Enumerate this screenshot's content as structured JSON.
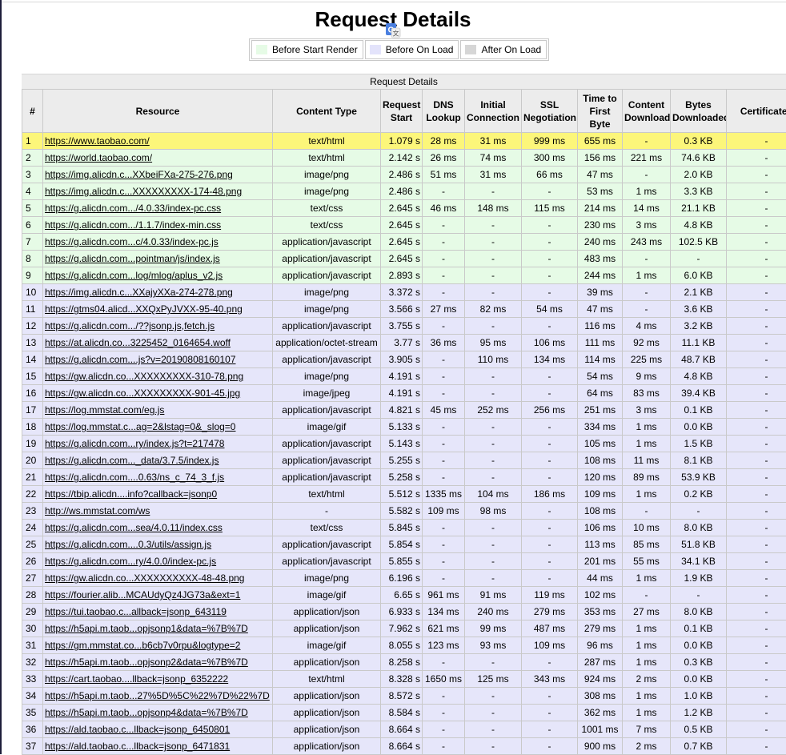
{
  "page": {
    "title": "Request Details"
  },
  "legend": [
    {
      "label": "Before Start Render",
      "color": "#e6fbe6"
    },
    {
      "label": "Before On Load",
      "color": "#e3e3fb"
    },
    {
      "label": "After On Load",
      "color": "#d6d6d6"
    }
  ],
  "table": {
    "caption": "Request Details",
    "headers": [
      "#",
      "Resource",
      "Content Type",
      "Request Start",
      "DNS Lookup",
      "Initial Connection",
      "SSL Negotiation",
      "Time to First Byte",
      "Content Download",
      "Bytes Downloaded",
      "Certificates"
    ],
    "row_colors": {
      "highlight": "#fcf67a",
      "start_render": "#e6fbe6",
      "on_load": "#e6e6fa"
    },
    "rows": [
      {
        "n": "1",
        "url": "https://www.taobao.com/",
        "type": "text/html",
        "start": "1.079 s",
        "dns": "28 ms",
        "conn": "31 ms",
        "ssl": "999 ms",
        "ttfb": "655 ms",
        "dl": "-",
        "bytes": "0.3 KB",
        "cert": "-",
        "phase": "highlight"
      },
      {
        "n": "2",
        "url": "https://world.taobao.com/",
        "type": "text/html",
        "start": "2.142 s",
        "dns": "26 ms",
        "conn": "74 ms",
        "ssl": "300 ms",
        "ttfb": "156 ms",
        "dl": "221 ms",
        "bytes": "74.6 KB",
        "cert": "-",
        "phase": "start_render"
      },
      {
        "n": "3",
        "url": "https://img.alicdn.c...XXbeiFXa-275-276.png",
        "type": "image/png",
        "start": "2.486 s",
        "dns": "51 ms",
        "conn": "31 ms",
        "ssl": "66 ms",
        "ttfb": "47 ms",
        "dl": "-",
        "bytes": "2.0 KB",
        "cert": "-",
        "phase": "start_render"
      },
      {
        "n": "4",
        "url": "https://img.alicdn.c...XXXXXXXXX-174-48.png",
        "type": "image/png",
        "start": "2.486 s",
        "dns": "-",
        "conn": "-",
        "ssl": "-",
        "ttfb": "53 ms",
        "dl": "1 ms",
        "bytes": "3.3 KB",
        "cert": "-",
        "phase": "start_render"
      },
      {
        "n": "5",
        "url": "https://g.alicdn.com.../4.0.33/index-pc.css",
        "type": "text/css",
        "start": "2.645 s",
        "dns": "46 ms",
        "conn": "148 ms",
        "ssl": "115 ms",
        "ttfb": "214 ms",
        "dl": "14 ms",
        "bytes": "21.1 KB",
        "cert": "-",
        "phase": "start_render"
      },
      {
        "n": "6",
        "url": "https://g.alicdn.com.../1.1.7/index-min.css",
        "type": "text/css",
        "start": "2.645 s",
        "dns": "-",
        "conn": "-",
        "ssl": "-",
        "ttfb": "230 ms",
        "dl": "3 ms",
        "bytes": "4.8 KB",
        "cert": "-",
        "phase": "start_render"
      },
      {
        "n": "7",
        "url": "https://g.alicdn.com...c/4.0.33/index-pc.js",
        "type": "application/javascript",
        "start": "2.645 s",
        "dns": "-",
        "conn": "-",
        "ssl": "-",
        "ttfb": "240 ms",
        "dl": "243 ms",
        "bytes": "102.5 KB",
        "cert": "-",
        "phase": "start_render"
      },
      {
        "n": "8",
        "url": "https://g.alicdn.com...pointman/js/index.js",
        "type": "application/javascript",
        "start": "2.645 s",
        "dns": "-",
        "conn": "-",
        "ssl": "-",
        "ttfb": "483 ms",
        "dl": "-",
        "bytes": "-",
        "cert": "-",
        "phase": "start_render"
      },
      {
        "n": "9",
        "url": "https://g.alicdn.com...log/mlog/aplus_v2.js",
        "type": "application/javascript",
        "start": "2.893 s",
        "dns": "-",
        "conn": "-",
        "ssl": "-",
        "ttfb": "244 ms",
        "dl": "1 ms",
        "bytes": "6.0 KB",
        "cert": "-",
        "phase": "start_render"
      },
      {
        "n": "10",
        "url": "https://img.alicdn.c...XXajyXXa-274-278.png",
        "type": "image/png",
        "start": "3.372 s",
        "dns": "-",
        "conn": "-",
        "ssl": "-",
        "ttfb": "39 ms",
        "dl": "-",
        "bytes": "2.1 KB",
        "cert": "-",
        "phase": "on_load"
      },
      {
        "n": "11",
        "url": "https://gtms04.alicd...XXQxPyJVXX-95-40.png",
        "type": "image/png",
        "start": "3.566 s",
        "dns": "27 ms",
        "conn": "82 ms",
        "ssl": "54 ms",
        "ttfb": "47 ms",
        "dl": "-",
        "bytes": "3.6 KB",
        "cert": "-",
        "phase": "on_load"
      },
      {
        "n": "12",
        "url": "https://g.alicdn.com.../??jsonp.js,fetch.js",
        "type": "application/javascript",
        "start": "3.755 s",
        "dns": "-",
        "conn": "-",
        "ssl": "-",
        "ttfb": "116 ms",
        "dl": "4 ms",
        "bytes": "3.2 KB",
        "cert": "-",
        "phase": "on_load"
      },
      {
        "n": "13",
        "url": "https://at.alicdn.co...3225452_0164654.woff",
        "type": "application/octet-stream",
        "start": "3.77 s",
        "dns": "36 ms",
        "conn": "95 ms",
        "ssl": "106 ms",
        "ttfb": "111 ms",
        "dl": "92 ms",
        "bytes": "11.1 KB",
        "cert": "-",
        "phase": "on_load"
      },
      {
        "n": "14",
        "url": "https://g.alicdn.com....js?v=20190808160107",
        "type": "application/javascript",
        "start": "3.905 s",
        "dns": "-",
        "conn": "110 ms",
        "ssl": "134 ms",
        "ttfb": "114 ms",
        "dl": "225 ms",
        "bytes": "48.7 KB",
        "cert": "-",
        "phase": "on_load"
      },
      {
        "n": "15",
        "url": "https://gw.alicdn.co...XXXXXXXXX-310-78.png",
        "type": "image/png",
        "start": "4.191 s",
        "dns": "-",
        "conn": "-",
        "ssl": "-",
        "ttfb": "54 ms",
        "dl": "9 ms",
        "bytes": "4.8 KB",
        "cert": "-",
        "phase": "on_load"
      },
      {
        "n": "16",
        "url": "https://gw.alicdn.co...XXXXXXXXX-901-45.jpg",
        "type": "image/jpeg",
        "start": "4.191 s",
        "dns": "-",
        "conn": "-",
        "ssl": "-",
        "ttfb": "64 ms",
        "dl": "83 ms",
        "bytes": "39.4 KB",
        "cert": "-",
        "phase": "on_load"
      },
      {
        "n": "17",
        "url": "https://log.mmstat.com/eg.js",
        "type": "application/javascript",
        "start": "4.821 s",
        "dns": "45 ms",
        "conn": "252 ms",
        "ssl": "256 ms",
        "ttfb": "251 ms",
        "dl": "3 ms",
        "bytes": "0.1 KB",
        "cert": "-",
        "phase": "on_load"
      },
      {
        "n": "18",
        "url": "https://log.mmstat.c...ag=2&lstag=0&_slog=0",
        "type": "image/gif",
        "start": "5.133 s",
        "dns": "-",
        "conn": "-",
        "ssl": "-",
        "ttfb": "334 ms",
        "dl": "1 ms",
        "bytes": "0.0 KB",
        "cert": "-",
        "phase": "on_load"
      },
      {
        "n": "19",
        "url": "https://g.alicdn.com...ry/index.js?t=217478",
        "type": "application/javascript",
        "start": "5.143 s",
        "dns": "-",
        "conn": "-",
        "ssl": "-",
        "ttfb": "105 ms",
        "dl": "1 ms",
        "bytes": "1.5 KB",
        "cert": "-",
        "phase": "on_load"
      },
      {
        "n": "20",
        "url": "https://g.alicdn.com..._data/3.7.5/index.js",
        "type": "application/javascript",
        "start": "5.255 s",
        "dns": "-",
        "conn": "-",
        "ssl": "-",
        "ttfb": "108 ms",
        "dl": "11 ms",
        "bytes": "8.1 KB",
        "cert": "-",
        "phase": "on_load"
      },
      {
        "n": "21",
        "url": "https://g.alicdn.com....0.63/ns_c_74_3_f.js",
        "type": "application/javascript",
        "start": "5.258 s",
        "dns": "-",
        "conn": "-",
        "ssl": "-",
        "ttfb": "120 ms",
        "dl": "89 ms",
        "bytes": "53.9 KB",
        "cert": "-",
        "phase": "on_load"
      },
      {
        "n": "22",
        "url": "https://tbip.alicdn....info?callback=jsonp0",
        "type": "text/html",
        "start": "5.512 s",
        "dns": "1335 ms",
        "conn": "104 ms",
        "ssl": "186 ms",
        "ttfb": "109 ms",
        "dl": "1 ms",
        "bytes": "0.2 KB",
        "cert": "-",
        "phase": "on_load"
      },
      {
        "n": "23",
        "url": "http://ws.mmstat.com/ws",
        "type": "-",
        "start": "5.582 s",
        "dns": "109 ms",
        "conn": "98 ms",
        "ssl": "-",
        "ttfb": "108 ms",
        "dl": "-",
        "bytes": "-",
        "cert": "-",
        "phase": "on_load"
      },
      {
        "n": "24",
        "url": "https://g.alicdn.com...sea/4.0.11/index.css",
        "type": "text/css",
        "start": "5.845 s",
        "dns": "-",
        "conn": "-",
        "ssl": "-",
        "ttfb": "106 ms",
        "dl": "10 ms",
        "bytes": "8.0 KB",
        "cert": "-",
        "phase": "on_load"
      },
      {
        "n": "25",
        "url": "https://g.alicdn.com....0.3/utils/assign.js",
        "type": "application/javascript",
        "start": "5.854 s",
        "dns": "-",
        "conn": "-",
        "ssl": "-",
        "ttfb": "113 ms",
        "dl": "85 ms",
        "bytes": "51.8 KB",
        "cert": "-",
        "phase": "on_load"
      },
      {
        "n": "26",
        "url": "https://g.alicdn.com...ry/4.0.0/index-pc.js",
        "type": "application/javascript",
        "start": "5.855 s",
        "dns": "-",
        "conn": "-",
        "ssl": "-",
        "ttfb": "201 ms",
        "dl": "55 ms",
        "bytes": "34.1 KB",
        "cert": "-",
        "phase": "on_load"
      },
      {
        "n": "27",
        "url": "https://gw.alicdn.co...XXXXXXXXXX-48-48.png",
        "type": "image/png",
        "start": "6.196 s",
        "dns": "-",
        "conn": "-",
        "ssl": "-",
        "ttfb": "44 ms",
        "dl": "1 ms",
        "bytes": "1.9 KB",
        "cert": "-",
        "phase": "on_load"
      },
      {
        "n": "28",
        "url": "https://fourier.alib...MCAUdyQz4JG73a&ext=1",
        "type": "image/gif",
        "start": "6.65 s",
        "dns": "961 ms",
        "conn": "91 ms",
        "ssl": "119 ms",
        "ttfb": "102 ms",
        "dl": "-",
        "bytes": "-",
        "cert": "-",
        "phase": "on_load"
      },
      {
        "n": "29",
        "url": "https://tui.taobao.c...allback=jsonp_643119",
        "type": "application/json",
        "start": "6.933 s",
        "dns": "134 ms",
        "conn": "240 ms",
        "ssl": "279 ms",
        "ttfb": "353 ms",
        "dl": "27 ms",
        "bytes": "8.0 KB",
        "cert": "-",
        "phase": "on_load"
      },
      {
        "n": "30",
        "url": "https://h5api.m.taob...opjsonp1&data=%7B%7D",
        "type": "application/json",
        "start": "7.962 s",
        "dns": "621 ms",
        "conn": "99 ms",
        "ssl": "487 ms",
        "ttfb": "279 ms",
        "dl": "1 ms",
        "bytes": "0.1 KB",
        "cert": "-",
        "phase": "on_load"
      },
      {
        "n": "31",
        "url": "https://gm.mmstat.co...b6cb7v0rpu&logtype=2",
        "type": "image/gif",
        "start": "8.055 s",
        "dns": "123 ms",
        "conn": "93 ms",
        "ssl": "109 ms",
        "ttfb": "96 ms",
        "dl": "1 ms",
        "bytes": "0.0 KB",
        "cert": "-",
        "phase": "on_load"
      },
      {
        "n": "32",
        "url": "https://h5api.m.taob...opjsonp2&data=%7B%7D",
        "type": "application/json",
        "start": "8.258 s",
        "dns": "-",
        "conn": "-",
        "ssl": "-",
        "ttfb": "287 ms",
        "dl": "1 ms",
        "bytes": "0.3 KB",
        "cert": "-",
        "phase": "on_load"
      },
      {
        "n": "33",
        "url": "https://cart.taobao....llback=jsonp_6352222",
        "type": "text/html",
        "start": "8.328 s",
        "dns": "1650 ms",
        "conn": "125 ms",
        "ssl": "343 ms",
        "ttfb": "924 ms",
        "dl": "2 ms",
        "bytes": "0.0 KB",
        "cert": "-",
        "phase": "on_load"
      },
      {
        "n": "34",
        "url": "https://h5api.m.taob...27%5D%5C%22%7D%22%7D",
        "type": "application/json",
        "start": "8.572 s",
        "dns": "-",
        "conn": "-",
        "ssl": "-",
        "ttfb": "308 ms",
        "dl": "1 ms",
        "bytes": "1.0 KB",
        "cert": "-",
        "phase": "on_load"
      },
      {
        "n": "35",
        "url": "https://h5api.m.taob...opjsonp4&data=%7B%7D",
        "type": "application/json",
        "start": "8.584 s",
        "dns": "-",
        "conn": "-",
        "ssl": "-",
        "ttfb": "362 ms",
        "dl": "1 ms",
        "bytes": "1.2 KB",
        "cert": "-",
        "phase": "on_load"
      },
      {
        "n": "36",
        "url": "https://ald.taobao.c...llback=jsonp_6450801",
        "type": "application/json",
        "start": "8.664 s",
        "dns": "-",
        "conn": "-",
        "ssl": "-",
        "ttfb": "1001 ms",
        "dl": "7 ms",
        "bytes": "0.5 KB",
        "cert": "-",
        "phase": "on_load"
      },
      {
        "n": "37",
        "url": "https://ald.taobao.c...llback=jsonp_6471831",
        "type": "application/json",
        "start": "8.664 s",
        "dns": "-",
        "conn": "-",
        "ssl": "-",
        "ttfb": "900 ms",
        "dl": "2 ms",
        "bytes": "0.7 KB",
        "cert": "-",
        "phase": "on_load"
      }
    ]
  }
}
